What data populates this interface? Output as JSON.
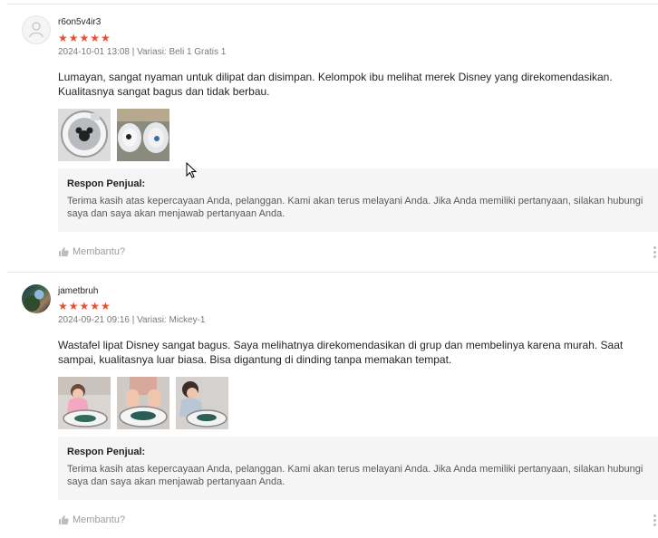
{
  "reviews": [
    {
      "username": "r6on5v4ir3",
      "avatar_icon": "user-placeholder-icon",
      "stars": "★★★★★",
      "rating": 5,
      "meta": "2024-10-01 13:08 | Variasi: Beli 1 Gratis 1",
      "content": "Lumayan, sangat nyaman untuk dilipat dan disimpan. Kelompok ibu melihat merek Disney yang direkomendasikan. Kualitasnya sangat bagus dan tidak berbau.",
      "images": [
        "mickey-sink-photo",
        "folding-sinks-photo"
      ],
      "seller_title": "Respon Penjual:",
      "seller_text": "Terima kasih atas kepercayaan Anda, pelanggan. Kami akan terus melayani Anda. Jika Anda memiliki pertanyaan, silakan hubungi saya dan saya akan menjawab pertanyaan Anda.",
      "helpful_label": "Membantu?"
    },
    {
      "username": "jametbruh",
      "avatar_icon": "user-photo-avatar",
      "stars": "★★★★★",
      "rating": 5,
      "meta": "2024-09-21 09:16 | Variasi: Mickey-1",
      "content": "Wastafel lipat Disney sangat bagus. Saya melihatnya direkomendasikan di grup dan membelinya karena murah. Saat sampai, kualitasnya luar biasa. Bisa digantung di dinding tanpa memakan tempat.",
      "images": [
        "child-washing-photo-1",
        "child-washing-photo-2",
        "child-washing-photo-3"
      ],
      "seller_title": "Respon Penjual:",
      "seller_text": "Terima kasih atas kepercayaan Anda, pelanggan. Kami akan terus melayani Anda. Jika Anda memiliki pertanyaan, silakan hubungi saya dan saya akan menjawab pertanyaan Anda.",
      "helpful_label": "Membantu?"
    }
  ],
  "colors": {
    "star": "#ee4d2d",
    "seller_bg": "#f5f5f5",
    "divider": "#e8e8e8"
  }
}
